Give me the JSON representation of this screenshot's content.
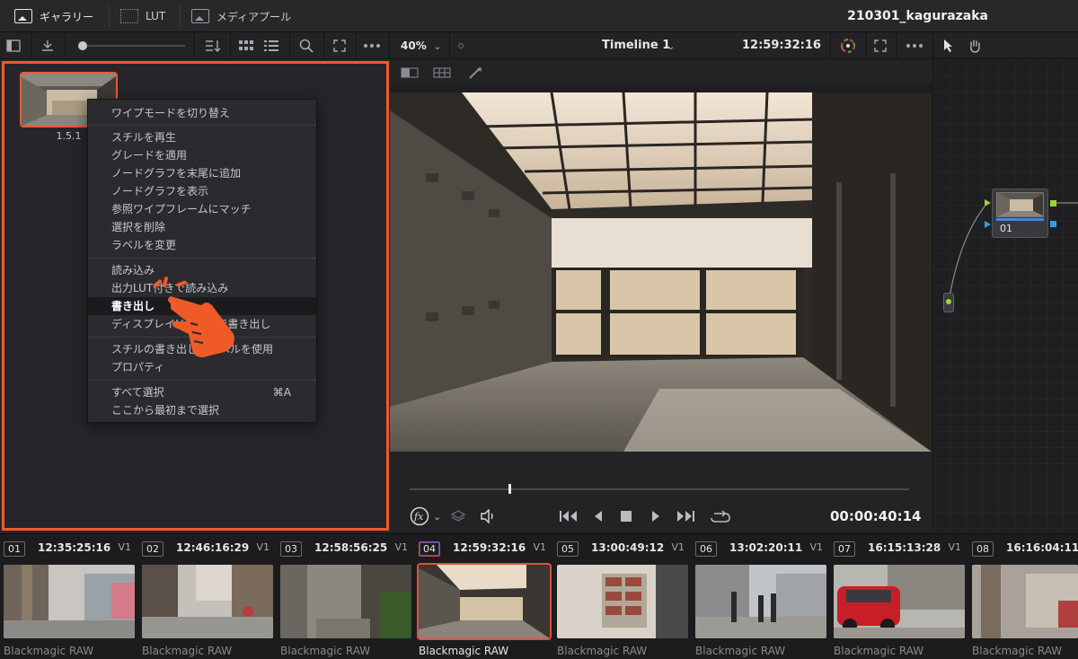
{
  "tabs": {
    "gallery": "ギャラリー",
    "lut": "LUT",
    "media_pool": "メディアプール"
  },
  "project_title": "210301_kagurazaka",
  "toolbar": {
    "zoom": "40%",
    "timeline": "Timeline 1",
    "timecode": "12:59:32:16",
    "icons": [
      "sidebar-icon",
      "import-icon",
      "sort-icon",
      "grid-view-icon",
      "list-view-icon",
      "search-icon",
      "fullscreen-icon",
      "more-icon",
      "color-picker-icon",
      "pointer-icon",
      "hand-icon"
    ]
  },
  "still": {
    "label": "1.5.1"
  },
  "context_menu": {
    "items": [
      {
        "label": "ワイプモードを切り替え"
      },
      {
        "label": "スチルを再生"
      },
      {
        "label": "グレードを適用"
      },
      {
        "label": "ノードグラフを末尾に追加"
      },
      {
        "label": "ノードグラフを表示"
      },
      {
        "label": "参照ワイプフレームにマッチ"
      },
      {
        "label": "選択を削除"
      },
      {
        "label": "ラベルを変更"
      },
      {
        "label": "読み込み"
      },
      {
        "label": "出力LUT付きで読み込み"
      },
      {
        "label": "書き出し"
      },
      {
        "label": "ディスプレイLUT付きで書き出し"
      },
      {
        "label": "スチルの書き出しにラベルを使用"
      },
      {
        "label": "プロパティ"
      },
      {
        "label": "すべて選択",
        "shortcut": "⌘A"
      },
      {
        "label": "ここから最初まで選択"
      }
    ],
    "highlighted": "書き出し"
  },
  "viewer": {
    "playback_timecode": "00:00:40:14"
  },
  "node": {
    "label": "01"
  },
  "clips": [
    {
      "num": "01",
      "timecode": "12:35:25:16",
      "track": "V1",
      "codec": "Blackmagic RAW"
    },
    {
      "num": "02",
      "timecode": "12:46:16:29",
      "track": "V1",
      "codec": "Blackmagic RAW"
    },
    {
      "num": "03",
      "timecode": "12:58:56:25",
      "track": "V1",
      "codec": "Blackmagic RAW"
    },
    {
      "num": "04",
      "timecode": "12:59:32:16",
      "track": "V1",
      "codec": "Blackmagic RAW",
      "active": true
    },
    {
      "num": "05",
      "timecode": "13:00:49:12",
      "track": "V1",
      "codec": "Blackmagic RAW"
    },
    {
      "num": "06",
      "timecode": "13:02:20:11",
      "track": "V1",
      "codec": "Blackmagic RAW"
    },
    {
      "num": "07",
      "timecode": "16:15:13:28",
      "track": "V1",
      "codec": "Blackmagic RAW"
    },
    {
      "num": "08",
      "timecode": "16:16:04:11",
      "track": "",
      "codec": "Blackmagic RAW"
    }
  ],
  "colors": {
    "accent": "#f05a28",
    "node_bar": "#4c86d8"
  }
}
